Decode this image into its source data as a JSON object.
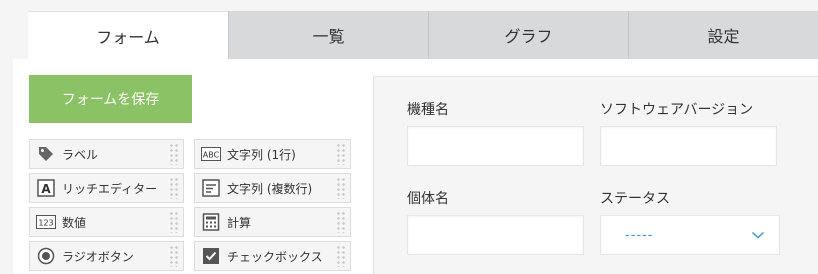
{
  "tabs": [
    {
      "label": "フォーム",
      "active": true
    },
    {
      "label": "一覧",
      "active": false
    },
    {
      "label": "グラフ",
      "active": false
    },
    {
      "label": "設定",
      "active": false
    }
  ],
  "save_button": {
    "label": "フォームを保存"
  },
  "palette": {
    "items": [
      {
        "label": "ラベル",
        "icon": "tag-icon"
      },
      {
        "label": "文字列 (1行)",
        "icon": "abc-text-icon"
      },
      {
        "label": "リッチエディター",
        "icon": "rich-text-icon"
      },
      {
        "label": "文字列 (複数行)",
        "icon": "multiline-text-icon"
      },
      {
        "label": "数値",
        "icon": "number-icon"
      },
      {
        "label": "計算",
        "icon": "calculator-icon"
      },
      {
        "label": "ラジオボタン",
        "icon": "radio-button-icon"
      },
      {
        "label": "チェックボックス",
        "icon": "checkbox-icon"
      }
    ]
  },
  "form": {
    "fields": [
      {
        "label": "機種名",
        "type": "text",
        "value": ""
      },
      {
        "label": "ソフトウェアバージョン",
        "type": "text",
        "value": ""
      },
      {
        "label": "個体名",
        "type": "text",
        "value": ""
      },
      {
        "label": "ステータス",
        "type": "dropdown",
        "value": "-----"
      }
    ]
  },
  "colors": {
    "save_button": "#8cc266",
    "tab_inactive": "#d8d9da",
    "dropdown_value": "#3498db"
  }
}
